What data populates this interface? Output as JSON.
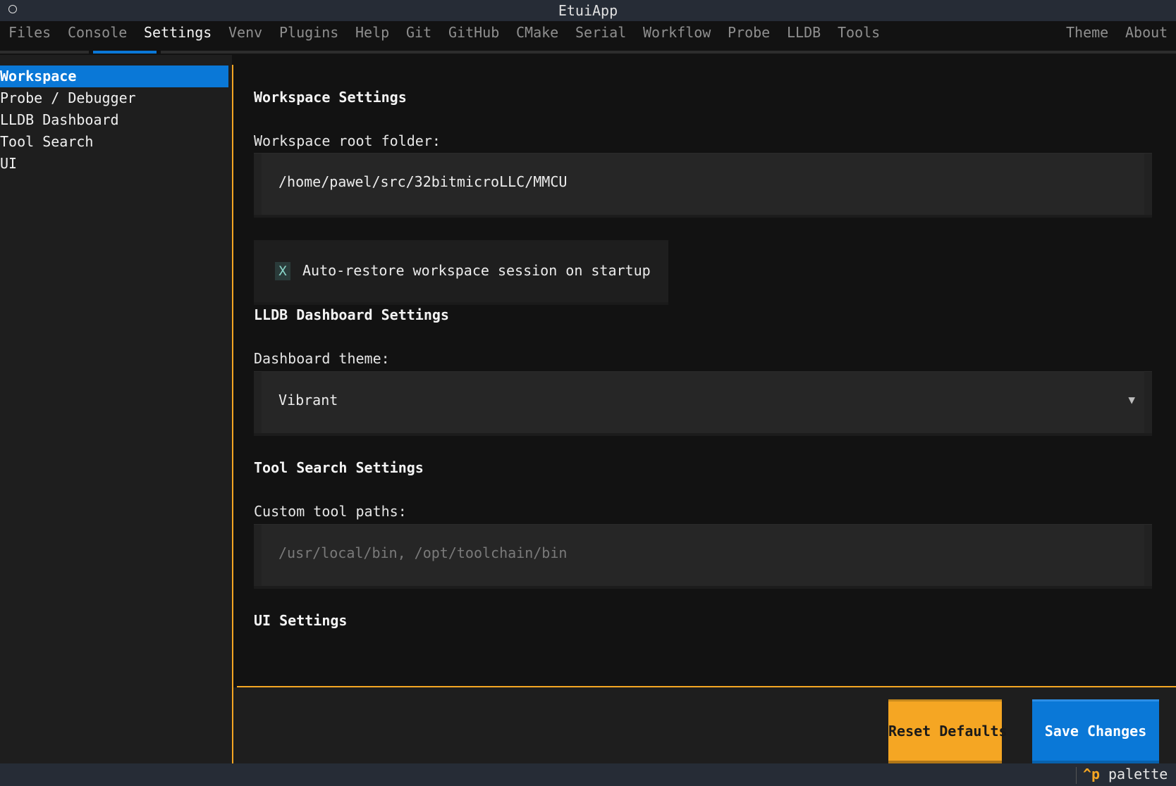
{
  "window": {
    "title": "EtuiApp"
  },
  "menu": {
    "items": [
      "Files",
      "Console",
      "Settings",
      "Venv",
      "Plugins",
      "Help",
      "Git",
      "GitHub",
      "CMake",
      "Serial",
      "Workflow",
      "Probe",
      "LLDB",
      "Tools"
    ],
    "right_items": [
      "Theme",
      "About"
    ],
    "active": "Settings"
  },
  "sidebar": {
    "items": [
      "Workspace",
      "Probe / Debugger",
      "LLDB Dashboard",
      "Tool Search",
      "UI"
    ],
    "active": "Workspace"
  },
  "workspace": {
    "heading": "Workspace Settings",
    "root_label": "Workspace root folder:",
    "root_value": "/home/pawel/src/32bitmicroLLC/MMCU",
    "auto_restore_checked": true,
    "auto_restore_mark": "X",
    "auto_restore_label": "Auto-restore workspace session on startup"
  },
  "lldb": {
    "heading": "LLDB Dashboard Settings",
    "theme_label": "Dashboard theme:",
    "theme_value": "Vibrant",
    "dropdown_arrow": "▼"
  },
  "tool_search": {
    "heading": "Tool Search Settings",
    "paths_label": "Custom tool paths:",
    "paths_placeholder": "/usr/local/bin, /opt/toolchain/bin"
  },
  "ui": {
    "heading": "UI Settings"
  },
  "buttons": {
    "reset": "Reset Defaults",
    "save": "Save Changes"
  },
  "status": {
    "key": "^p",
    "hint": "palette"
  },
  "colors": {
    "accent_orange": "#f5a623",
    "accent_blue": "#0a78d7"
  }
}
